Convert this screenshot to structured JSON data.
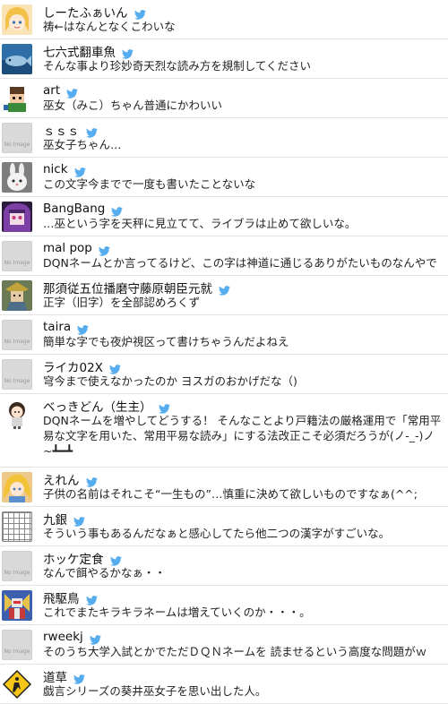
{
  "colors": {
    "bird": "#55acee",
    "border": "#e3e3e3"
  },
  "no_image_label": "No Image",
  "items": [
    {
      "name": "しーたふぁいん",
      "text": "祷←はなんとなくこわいな",
      "avatar": "girl-avatar"
    },
    {
      "name": "七六式翻車魚",
      "text": "そんな事より珍妙奇天烈な読み方を規制してください",
      "avatar": "fish-avatar"
    },
    {
      "name": "art",
      "text": "巫女（みこ）ちゃん普通にかわいい",
      "avatar": "pixel-avatar"
    },
    {
      "name": "ｓｓｓ",
      "text": "巫女子ちゃん…",
      "avatar": "no-image"
    },
    {
      "name": "nick",
      "text": "この文字今までで一度も書いたことないな",
      "avatar": "rabbit-avatar"
    },
    {
      "name": "BangBang",
      "text": "…巫という字を天秤に見立てて、ライブラは止めて欲しいな。",
      "avatar": "purple-avatar"
    },
    {
      "name": "mal pop",
      "text": "DQNネームとか言ってるけど、この字は神道に通じるありがたいものなんやで",
      "avatar": "no-image"
    },
    {
      "name": "那須従五位播磨守藤原朝臣元就",
      "text": "正字（旧字）を全部認めろくず",
      "avatar": "samurai-avatar"
    },
    {
      "name": "taira",
      "text": "簡単な字でも夜炉視区って書けちゃうんだよねえ",
      "avatar": "no-image"
    },
    {
      "name": "ライカ02X",
      "text": "穹今まで使えなかったのか ヨスガのおかげだな（)",
      "avatar": "no-image"
    },
    {
      "name": "べっきどん（生主）",
      "text": "DQNネームを増やしてどうする！ そんなことより戸籍法の厳格運用で「常用平易な文字を用いた、常用平易な読み」にする法改正こそ必須だろうが(ノ-_-)ノ~┻━┻",
      "avatar": "chibi-avatar"
    },
    {
      "name": "えれん",
      "text": "子供の名前はそれこそ“一生もの”…慎重に決めて欲しいものですなぁ(^^;",
      "avatar": "blonde-avatar"
    },
    {
      "name": "九銀",
      "text": "そういう事もあるんだなぁと感心してたら他二つの漢字がすごいな。",
      "avatar": "grid-avatar"
    },
    {
      "name": "ホッケ定食",
      "text": "なんで餌やるかなぁ・・",
      "avatar": "no-image"
    },
    {
      "name": "飛駆鳥",
      "text": "これでまたキラキラネームは増えていくのか・・・。",
      "avatar": "robot-avatar"
    },
    {
      "name": "rweekj",
      "text": "そのうち大学入試とかでただＤＱＮネームを 読ませるという高度な問題がｗ",
      "avatar": "no-image"
    },
    {
      "name": "道草",
      "text": "戯言シリーズの葵井巫女子を思い出した人。",
      "avatar": "warning-sign-avatar"
    }
  ]
}
